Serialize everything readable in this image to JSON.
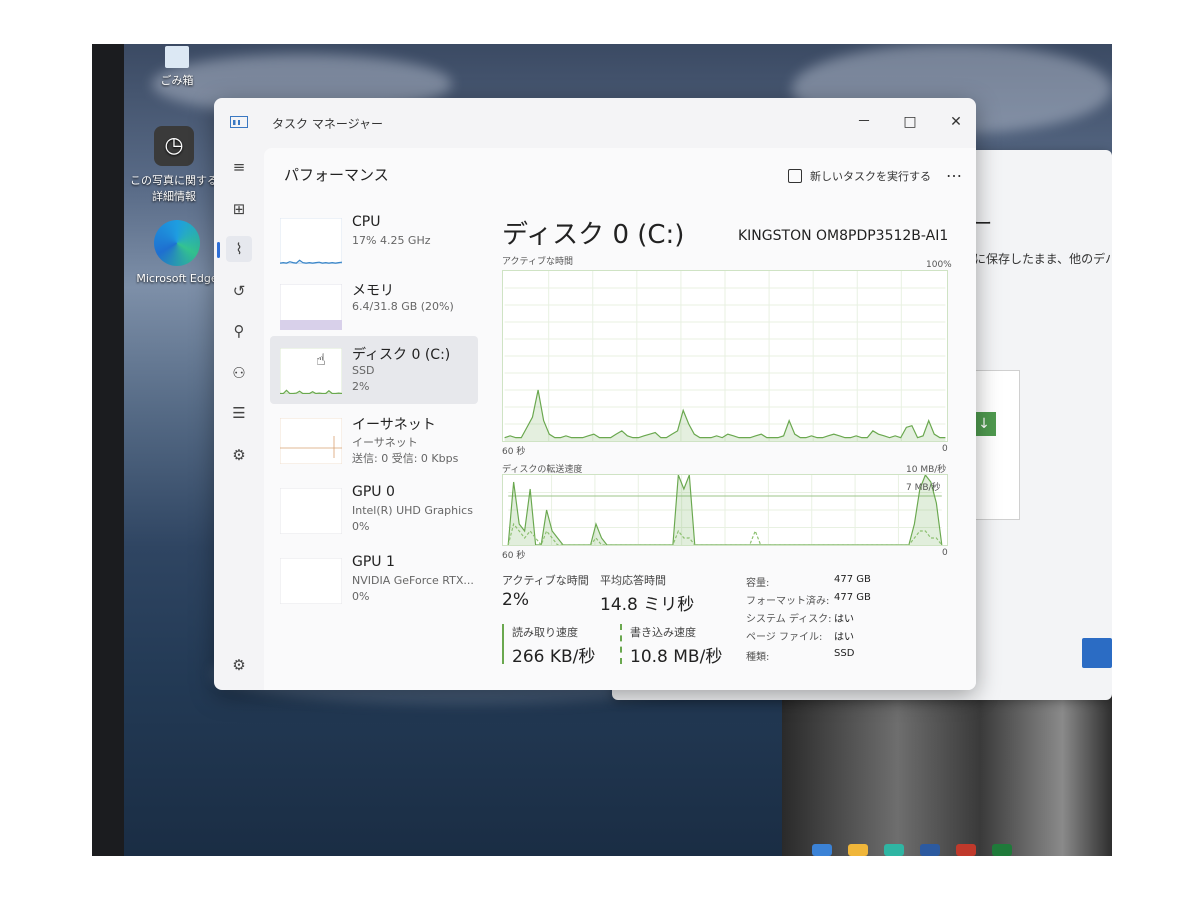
{
  "desktop": {
    "icons": [
      {
        "label": "ごみ箱"
      },
      {
        "label": "この写真に関する詳細情報"
      },
      {
        "label": "Microsoft Edge"
      }
    ]
  },
  "background_window": {
    "title_fragment": "ー",
    "text_fragment": "に保存したまま、他のデバ"
  },
  "window": {
    "title": "タスク マネージャー",
    "minimize": "－",
    "maximize": "□",
    "close": "✕"
  },
  "page": {
    "title": "パフォーマンス",
    "run_task": "新しいタスクを実行する",
    "more": "…"
  },
  "devices": [
    {
      "name": "CPU",
      "sub1": "17%  4.25 GHz",
      "sub2": ""
    },
    {
      "name": "メモリ",
      "sub1": "6.4/31.8 GB (20%)",
      "sub2": ""
    },
    {
      "name": "ディスク 0 (C:)",
      "sub1": "SSD",
      "sub2": "2%"
    },
    {
      "name": "イーサネット",
      "sub1": "イーサネット",
      "sub2": "送信: 0  受信: 0 Kbps"
    },
    {
      "name": "GPU 0",
      "sub1": "Intel(R) UHD Graphics",
      "sub2": "0%"
    },
    {
      "name": "GPU 1",
      "sub1": "NVIDIA GeForce RTX...",
      "sub2": "0%"
    }
  ],
  "detail": {
    "title": "ディスク 0 (C:)",
    "model": "KINGSTON OM8PDP3512B-AI1",
    "graph1": {
      "label": "アクティブな時間",
      "max": "100%",
      "time": "60 秒",
      "min": "0"
    },
    "graph2": {
      "label": "ディスクの転送速度",
      "max": "10 MB/秒",
      "mid": "7 MB/秒",
      "time": "60 秒",
      "min": "0"
    },
    "stats": {
      "active_label": "アクティブな時間",
      "active_value": "2%",
      "resp_label": "平均応答時間",
      "resp_value": "14.8 ミリ秒",
      "read_label": "読み取り速度",
      "read_value": "266 KB/秒",
      "write_label": "書き込み速度",
      "write_value": "10.8 MB/秒"
    },
    "info": [
      {
        "k": "容量:",
        "v": "477 GB"
      },
      {
        "k": "フォーマット済み:",
        "v": "477 GB"
      },
      {
        "k": "システム ディスク:",
        "v": "はい"
      },
      {
        "k": "ページ ファイル:",
        "v": "はい"
      },
      {
        "k": "種類:",
        "v": "SSD"
      }
    ]
  },
  "graph_series": {
    "active_time": [
      2,
      3,
      2,
      2,
      8,
      14,
      30,
      12,
      4,
      2,
      2,
      3,
      2,
      2,
      2,
      3,
      4,
      2,
      2,
      2,
      4,
      6,
      3,
      2,
      2,
      3,
      4,
      5,
      2,
      2,
      4,
      6,
      18,
      10,
      4,
      2,
      2,
      2,
      3,
      2,
      4,
      3,
      2,
      2,
      2,
      3,
      4,
      2,
      2,
      2,
      3,
      12,
      4,
      2,
      2,
      3,
      2,
      2,
      3,
      4,
      3,
      2,
      2,
      3,
      2,
      2,
      6,
      4,
      3,
      2,
      3,
      2,
      8,
      9,
      2,
      3,
      12,
      4,
      2,
      2
    ],
    "transfer_write": [
      0,
      9,
      3,
      2,
      8,
      0,
      0,
      5,
      2,
      1,
      0,
      0,
      0,
      0,
      0,
      0,
      3,
      1,
      0,
      0,
      0,
      0,
      0,
      0,
      0,
      0,
      0,
      0,
      0,
      0,
      0,
      10,
      8,
      10,
      0,
      0,
      0,
      0,
      0,
      0,
      0,
      0,
      0,
      0,
      0,
      0,
      0,
      0,
      0,
      0,
      0,
      0,
      0,
      0,
      0,
      0,
      0,
      0,
      0,
      0,
      0,
      0,
      0,
      0,
      0,
      0,
      0,
      0,
      0,
      0,
      0,
      0,
      0,
      0,
      3,
      8,
      10,
      9,
      6,
      0
    ],
    "transfer_read": [
      0,
      3,
      2,
      1,
      2,
      1,
      0,
      2,
      1,
      0,
      0,
      0,
      0,
      0,
      0,
      0,
      1,
      0,
      0,
      0,
      0,
      0,
      0,
      0,
      0,
      0,
      0,
      0,
      0,
      0,
      0,
      2,
      1,
      1,
      0,
      0,
      0,
      0,
      0,
      0,
      0,
      0,
      0,
      0,
      0,
      2,
      0,
      0,
      0,
      0,
      0,
      0,
      0,
      0,
      0,
      0,
      0,
      0,
      0,
      0,
      0,
      0,
      0,
      0,
      0,
      0,
      0,
      0,
      0,
      0,
      0,
      0,
      0,
      0,
      1,
      2,
      2,
      1,
      1,
      0
    ],
    "thumb_cpu": [
      2,
      3,
      2,
      5,
      3,
      2,
      8,
      3,
      2,
      3,
      2,
      3,
      4,
      2,
      3,
      2,
      3,
      2,
      3,
      4
    ],
    "thumb_disk": [
      1,
      1,
      8,
      1,
      1,
      2,
      6,
      1,
      1,
      1,
      5,
      1,
      2,
      1,
      1,
      7,
      1,
      1,
      2,
      1
    ]
  }
}
